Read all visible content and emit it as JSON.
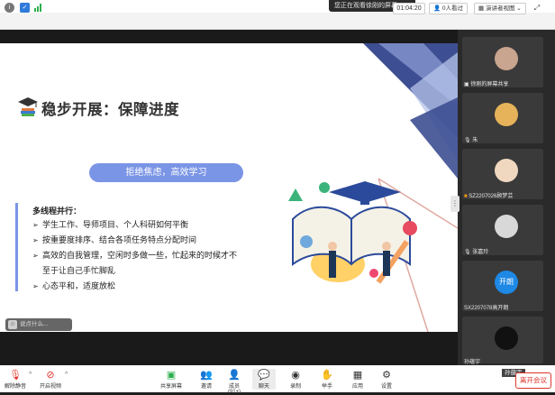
{
  "banner": {
    "text": "您正在观看徐刚的屏幕",
    "close": "×"
  },
  "toolbar": {
    "info_icon": "info-icon",
    "shield_icon": "shield-icon",
    "signal_icon": "signal-icon",
    "timer": "01:04:20",
    "viewers": "0人看过",
    "view_mode": "演讲者视图",
    "fullscreen": "⤢"
  },
  "slide": {
    "title": "稳步开展：保障进度",
    "pill": "拒绝焦虑，高效学习",
    "bullets_heading": "多线程并行：",
    "bullets": [
      "学生工作、导师项目、个人科研如何平衡",
      "按重要度排序、结合各项任务特点分配时间",
      "高效的自我管理，空闲时多做一些，忙起来的时候才不",
      "至于让自己手忙脚乱",
      "心态平和，适度放松"
    ],
    "bullet_arrow": "➢",
    "accent": "#7b95e6"
  },
  "chat": {
    "placeholder": "说点什么..."
  },
  "participants": [
    {
      "name": "徐刚的屏幕共享",
      "avatar_color": "#c9a48f"
    },
    {
      "name": "朱",
      "avatar_color": "#e6b35a"
    },
    {
      "name": "SZ2207026顾梦芸",
      "avatar_color": "#f0d8c0"
    },
    {
      "name": "张嘉玲",
      "avatar_color": "#d8d8d8"
    },
    {
      "name": "SX2207078高开朗",
      "avatar_text": "开朗",
      "avatar_color": "#1e88e5"
    },
    {
      "name": "孙蕴宇",
      "avatar_color": "#111111"
    }
  ],
  "pip_label": "孙蕴宇",
  "bottom": {
    "mute": "解除静音",
    "video": "开启视频",
    "share": "共享屏幕",
    "invite": "邀请",
    "members": "成员(91+)",
    "chat": "聊天",
    "record": "录制",
    "raise": "举手",
    "apps": "应用",
    "settings": "设置",
    "leave": "离开会议"
  }
}
